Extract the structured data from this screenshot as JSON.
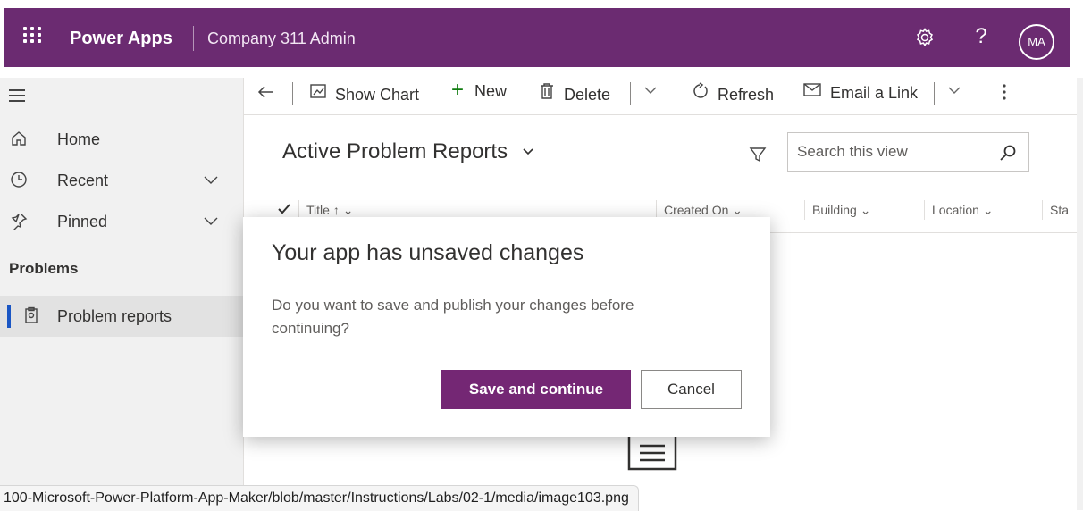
{
  "topbar": {
    "app_name": "Power Apps",
    "environment": "Company 311 Admin",
    "settings_icon": "gear-icon",
    "help_label": "?",
    "avatar_initials": "MA",
    "brand_color": "#6b2b71"
  },
  "sidebar": {
    "items": [
      {
        "label": "Home",
        "icon": "home-icon"
      },
      {
        "label": "Recent",
        "icon": "clock-icon"
      },
      {
        "label": "Pinned",
        "icon": "pin-icon"
      }
    ],
    "section_title": "Problems",
    "selected_item": {
      "label": "Problem reports",
      "icon": "clipboard-icon"
    },
    "selection_color": "#1a56c4"
  },
  "toolbar": {
    "show_chart": "Show Chart",
    "new": "New",
    "delete": "Delete",
    "refresh": "Refresh",
    "email_link": "Email a Link"
  },
  "view": {
    "title": "Active Problem Reports",
    "search_placeholder": "Search this view",
    "columns": [
      "Title ↑",
      "Created On",
      "Building",
      "Location",
      "Sta"
    ]
  },
  "dialog": {
    "title": "Your app has unsaved changes",
    "message": "Do you want to save and publish your changes before continuing?",
    "primary_button": "Save and continue",
    "secondary_button": "Cancel",
    "primary_color": "#742774"
  },
  "status_bar": {
    "url": "100-Microsoft-Power-Platform-App-Maker/blob/master/Instructions/Labs/02-1/media/image103.png"
  }
}
